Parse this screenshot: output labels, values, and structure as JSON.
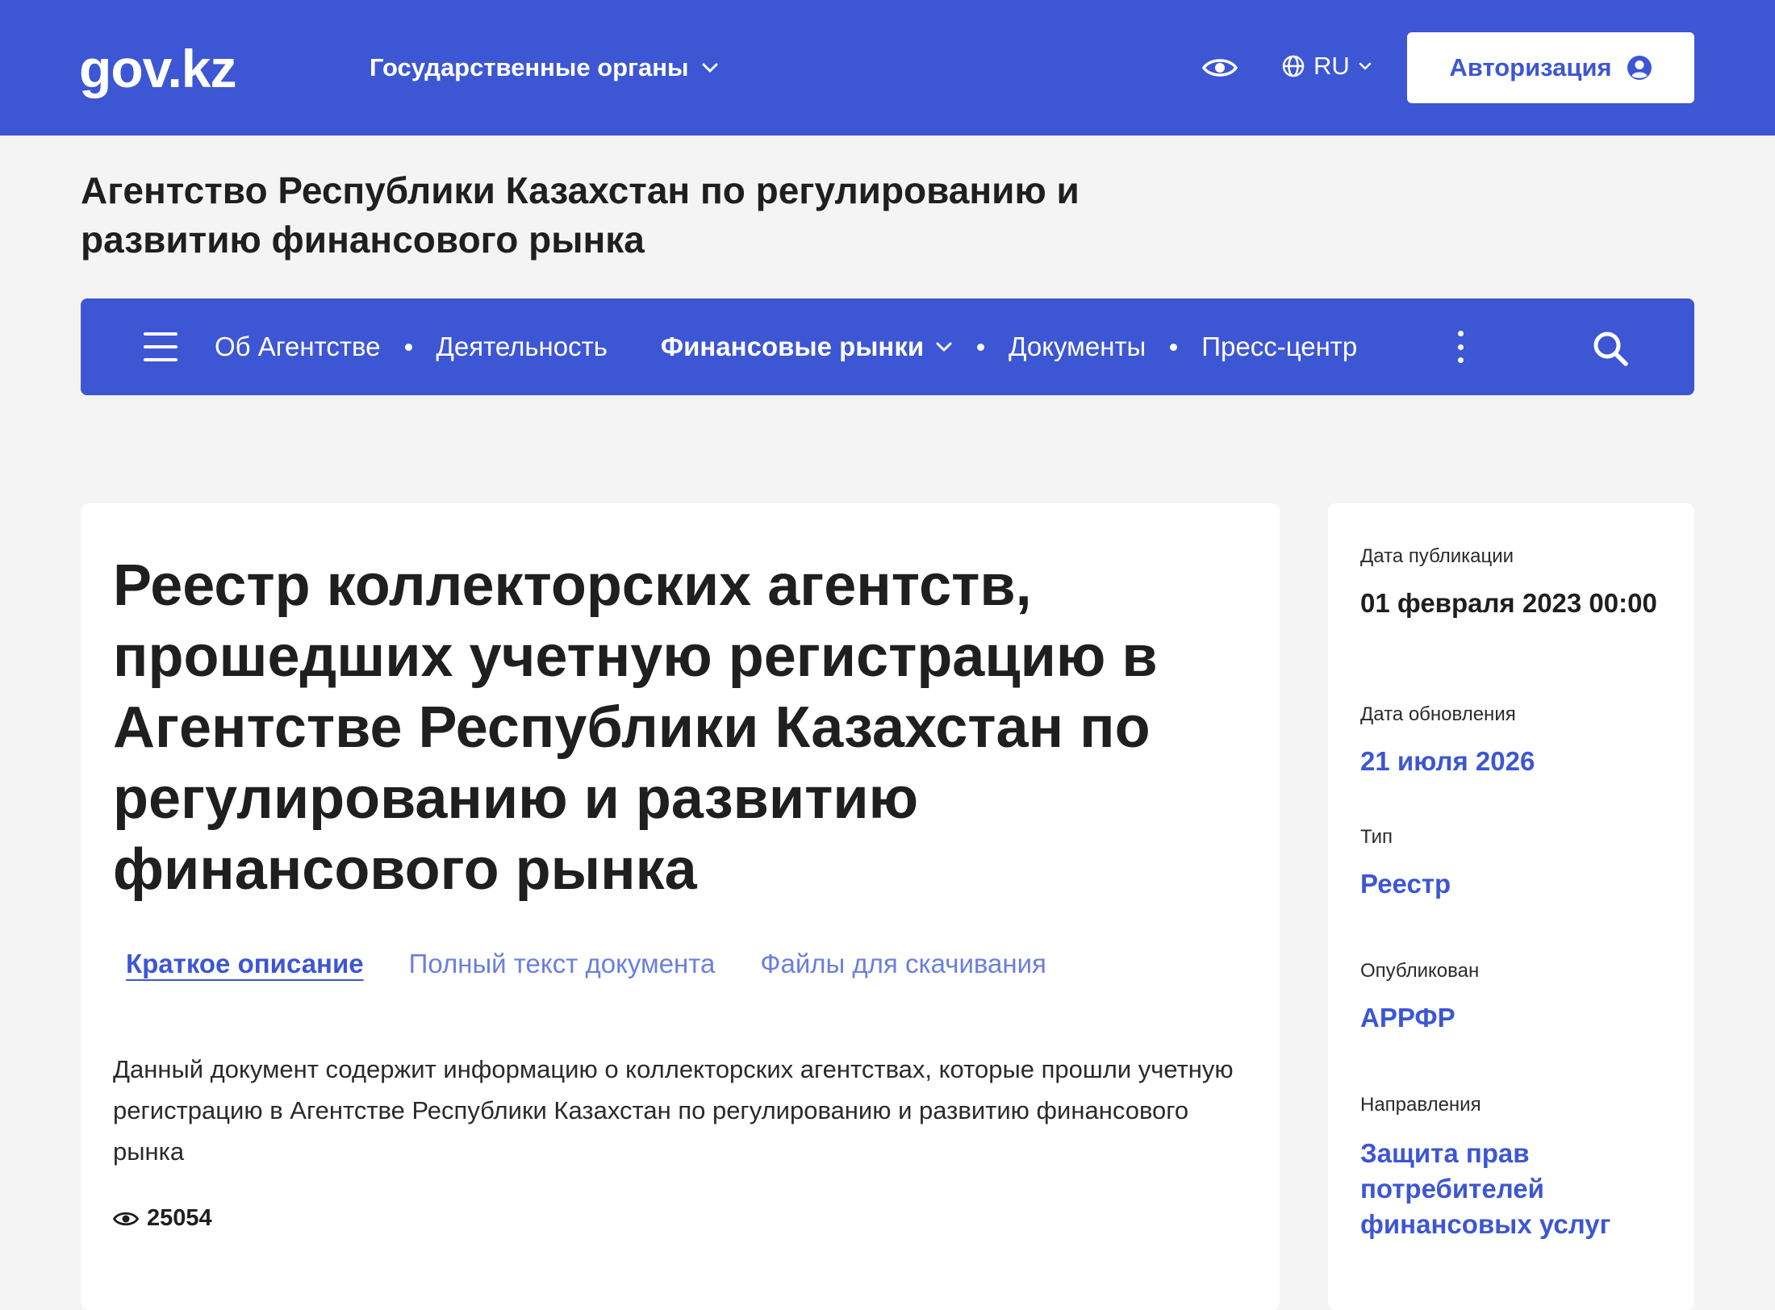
{
  "header": {
    "logo": "gov.kz",
    "gov_bodies_label": "Государственные органы",
    "language": "RU",
    "auth_label": "Авторизация",
    "brand_color": "#3d56d4"
  },
  "agency": {
    "title": "Агентство Республики Казахстан по регулированию и развитию финансового рынка"
  },
  "nav": {
    "items": [
      {
        "label": "Об Агентстве"
      },
      {
        "label": "Деятельность"
      },
      {
        "label": "Финансовые рынки"
      },
      {
        "label": "Документы"
      },
      {
        "label": "Пресс-центр"
      }
    ]
  },
  "document": {
    "title": "Реестр коллекторских агентств, прошедших учетную регистрацию в Агентстве Республики Казахстан по регулированию и развитию финансового рынка",
    "tabs": [
      {
        "label": "Краткое описание",
        "active": true
      },
      {
        "label": "Полный текст документа",
        "active": false
      },
      {
        "label": "Файлы для скачивания",
        "active": false
      }
    ],
    "summary": "Данный документ содержит информацию о коллекторских агентствах, которые прошли учетную регистрацию в Агентстве Республики Казахстан по регулированию и развитию финансового рынка",
    "views": "25054"
  },
  "meta": {
    "published_label": "Дата публикации",
    "published_value": "01 февраля 2023 00:00",
    "updated_label": "Дата обновления",
    "updated_value": "21 июля 2026",
    "type_label": "Тип",
    "type_value": "Реестр",
    "publisher_label": "Опубликован",
    "publisher_value": "АРРФР",
    "directions_label": "Направления",
    "directions_value": "Защита прав потребителей финансовых услуг"
  }
}
